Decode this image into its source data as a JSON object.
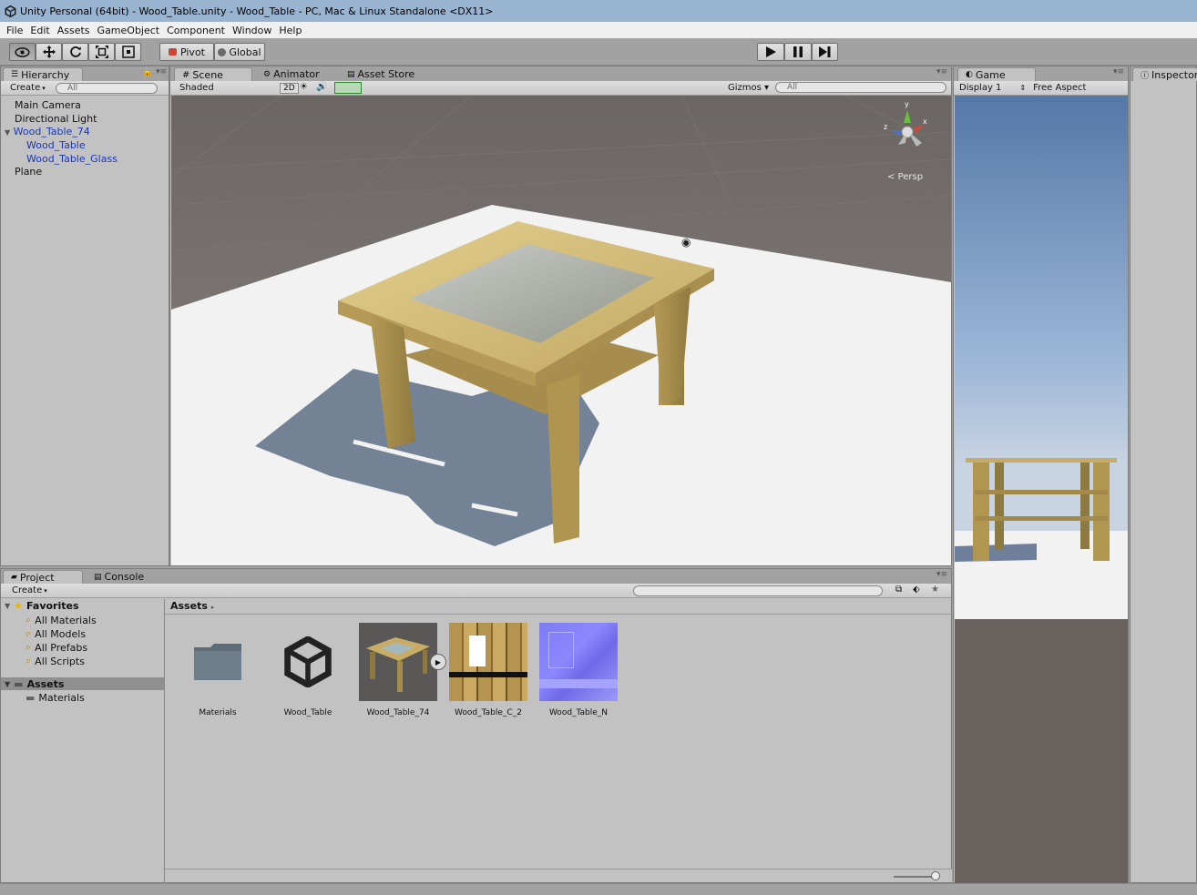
{
  "window": {
    "title": "Unity Personal (64bit) - Wood_Table.unity - Wood_Table - PC, Mac & Linux Standalone <DX11>"
  },
  "menu": [
    "File",
    "Edit",
    "Assets",
    "GameObject",
    "Component",
    "Window",
    "Help"
  ],
  "toolbar": {
    "tools": [
      "hand-tool",
      "move-tool",
      "rotate-tool",
      "scale-tool",
      "rect-tool"
    ],
    "pivot_label": "Pivot",
    "global_label": "Global"
  },
  "hierarchy": {
    "tab": "Hierarchy",
    "create_label": "Create",
    "search_placeholder": "All",
    "items": [
      "Main Camera",
      "Directional Light",
      "Wood_Table_74",
      "Wood_Table",
      "Wood_Table_Glass",
      "Plane"
    ]
  },
  "scene": {
    "tabs": [
      "Scene",
      "Animator",
      "Asset Store"
    ],
    "shading_mode": "Shaded",
    "mode_2d": "2D",
    "gizmos_label": "Gizmos",
    "search_placeholder": "All",
    "projection": "Persp",
    "axes": [
      "y",
      "x",
      "z"
    ]
  },
  "game": {
    "tab": "Game",
    "display": "Display 1",
    "aspect": "Free Aspect"
  },
  "inspector": {
    "tab": "Inspector"
  },
  "project": {
    "tabs": [
      "Project",
      "Console"
    ],
    "create_label": "Create",
    "favorites_label": "Favorites",
    "favorites": [
      "All Materials",
      "All Models",
      "All Prefabs",
      "All Scripts"
    ],
    "assets_label": "Assets",
    "asset_folders": [
      "Materials"
    ],
    "breadcrumb": "Assets",
    "assets": [
      "Materials",
      "Wood_Table",
      "Wood_Table_74",
      "Wood_Table_C_2",
      "Wood_Table_N"
    ]
  },
  "colors": {
    "title_bar": "#99b4d1",
    "panel_bg": "#c2c2c2",
    "scene_sky": "#7c7470",
    "hierarchy_child": "#1a37b5"
  }
}
